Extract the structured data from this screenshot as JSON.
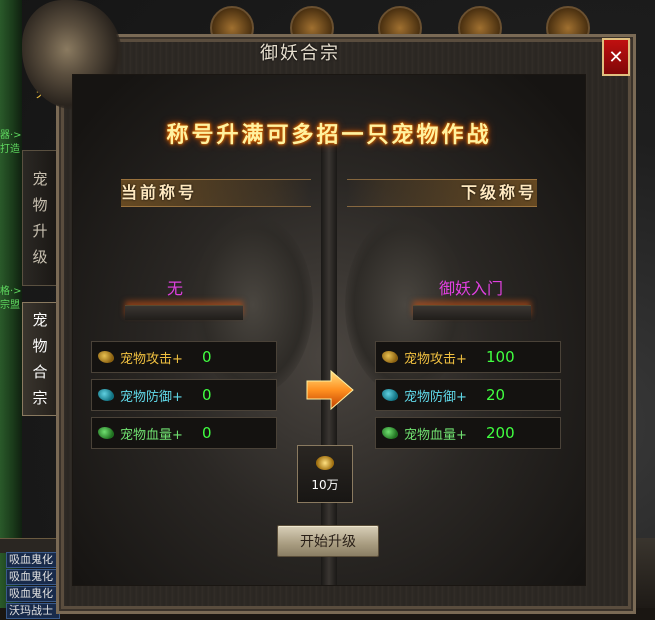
{
  "window": {
    "title": "御妖合宗",
    "close_label": "✕"
  },
  "side_tabs": [
    {
      "label": [
        "宠",
        "物",
        "升",
        "级"
      ],
      "active": false
    },
    {
      "label": [
        "宠",
        "物",
        "合",
        "宗"
      ],
      "active": true
    }
  ],
  "headline": "称号升满可多招一只宠物作战",
  "current": {
    "header": "当前称号",
    "title_name": "无",
    "stats": [
      {
        "label": "宠物攻击+",
        "value": "0"
      },
      {
        "label": "宠物防御+",
        "value": "0"
      },
      {
        "label": "宠物血量+",
        "value": "0"
      }
    ]
  },
  "next": {
    "header": "下级称号",
    "title_name": "御妖入门",
    "stats": [
      {
        "label": "宠物攻击+",
        "value": "100"
      },
      {
        "label": "宠物防御+",
        "value": "20"
      },
      {
        "label": "宠物血量+",
        "value": "200"
      }
    ]
  },
  "cost": {
    "amount": "10万"
  },
  "upgrade_button": "开始升级",
  "background": {
    "left_tags": [
      "器·>",
      "打造",
      "格·>",
      "宗盟",
      "天"
    ],
    "bottom_list": [
      "吸血鬼化",
      "吸血鬼化",
      "吸血鬼化",
      "沃玛战士"
    ]
  },
  "colors": {
    "title_name": "#e040e0",
    "stat_value": "#40ff40",
    "headline": "#fff2a0",
    "close_bg": "#c01010"
  }
}
